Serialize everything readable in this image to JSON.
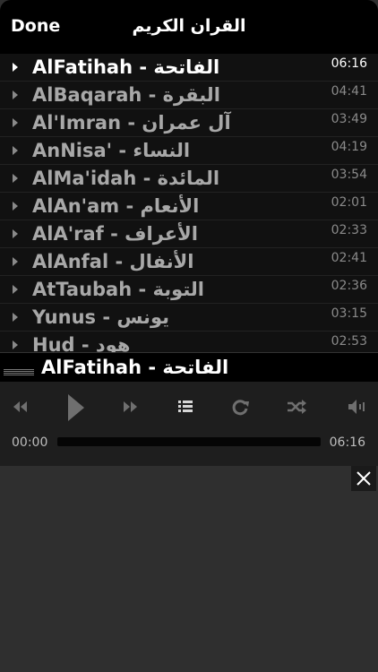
{
  "header": {
    "done_label": "Done",
    "title": "القران الكريم"
  },
  "tracks": [
    {
      "name": "AlFatihah - الفاتحة",
      "duration": "06:16",
      "active": true
    },
    {
      "name": "AlBaqarah - البقرة",
      "duration": "04:41",
      "active": false
    },
    {
      "name": "Al'Imran - آل عمران",
      "duration": "03:49",
      "active": false
    },
    {
      "name": "AnNisa' - النساء",
      "duration": "04:19",
      "active": false
    },
    {
      "name": "AlMa'idah - المائدة",
      "duration": "03:54",
      "active": false
    },
    {
      "name": "AlAn'am - الأنعام",
      "duration": "02:01",
      "active": false
    },
    {
      "name": "AlA'raf - الأعراف",
      "duration": "02:33",
      "active": false
    },
    {
      "name": "AlAnfal - الأنفال",
      "duration": "02:41",
      "active": false
    },
    {
      "name": "AtTaubah - التوبة",
      "duration": "02:36",
      "active": false
    },
    {
      "name": "Yunus - يونس",
      "duration": "03:15",
      "active": false
    },
    {
      "name": "Hud - هود",
      "duration": "02:53",
      "active": false
    }
  ],
  "now_playing": {
    "title": "AlFatihah - الفاتحة"
  },
  "player": {
    "current_time": "00:00",
    "total_time": "06:16",
    "progress": 0.0
  },
  "icons": {
    "rewind": "rewind-icon",
    "play": "play-icon",
    "forward": "fast-forward-icon",
    "playlist": "list-icon",
    "repeat": "repeat-icon",
    "shuffle": "shuffle-icon",
    "volume": "volume-icon",
    "close": "close-icon",
    "equalizer": "equalizer-icon"
  },
  "colors": {
    "active_text": "#ffffff",
    "inactive_text": "#a8a8a8",
    "control_icon": "#6f6f6f"
  }
}
